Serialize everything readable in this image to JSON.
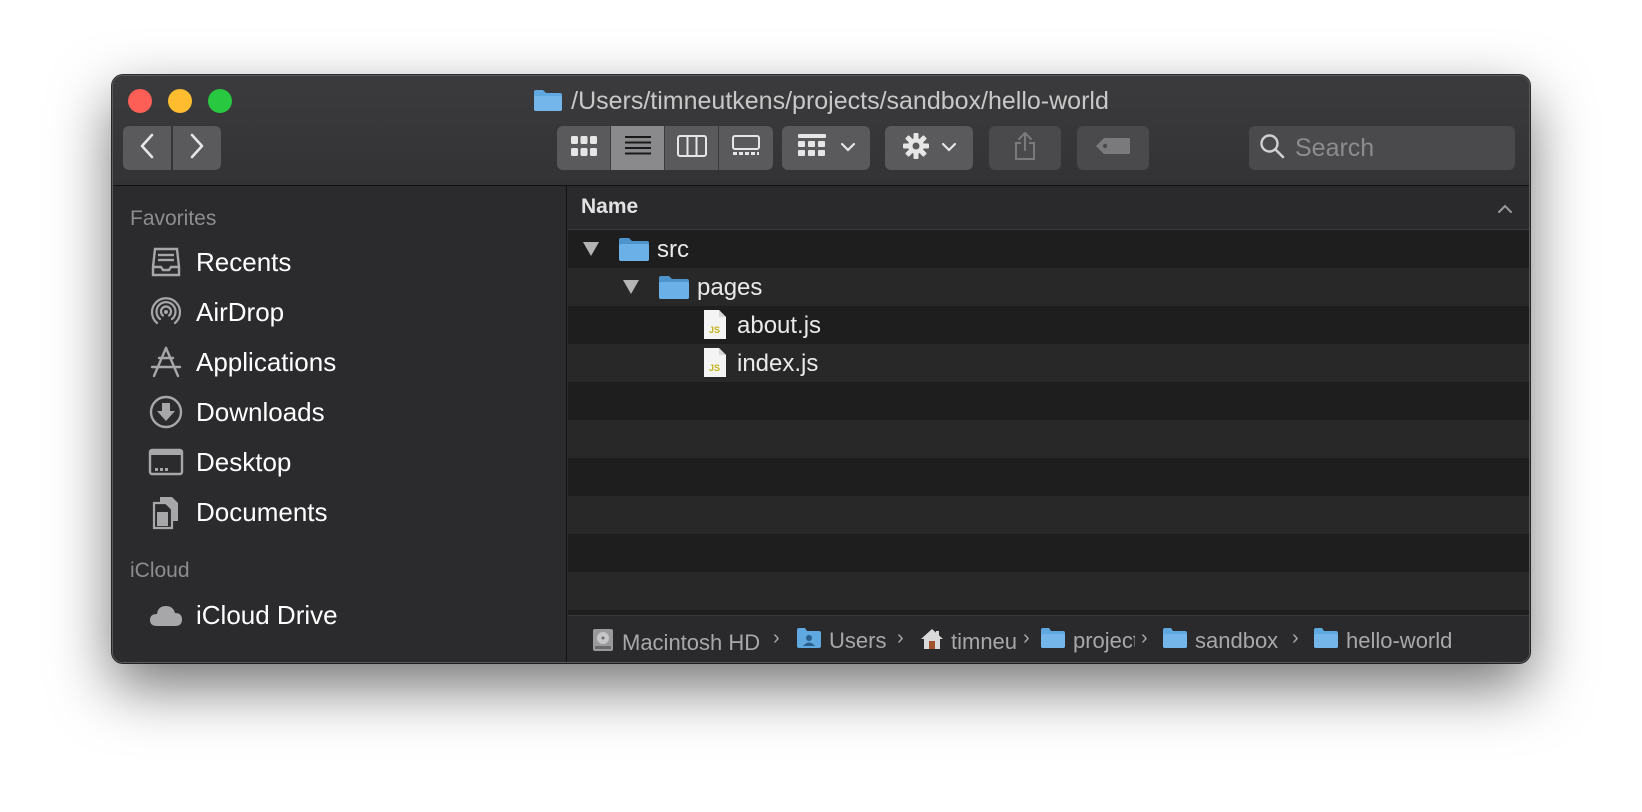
{
  "window": {
    "title": "/Users/timneutkens/projects/sandbox/hello-world"
  },
  "toolbar": {
    "back_icon": "chevron-left-icon",
    "forward_icon": "chevron-right-icon",
    "view_modes": [
      "icon-view-icon",
      "list-view-icon",
      "column-view-icon",
      "gallery-view-icon"
    ],
    "active_view": "list",
    "search_placeholder": "Search"
  },
  "sidebar": {
    "favorites_label": "Favorites",
    "icloud_label": "iCloud",
    "items": [
      {
        "label": "Recents",
        "icon": "recents-icon"
      },
      {
        "label": "AirDrop",
        "icon": "airdrop-icon"
      },
      {
        "label": "Applications",
        "icon": "applications-icon"
      },
      {
        "label": "Downloads",
        "icon": "downloads-icon"
      },
      {
        "label": "Desktop",
        "icon": "desktop-icon"
      },
      {
        "label": "Documents",
        "icon": "documents-icon"
      }
    ],
    "icloud_items": [
      {
        "label": "iCloud Drive",
        "icon": "cloud-icon"
      }
    ]
  },
  "list": {
    "column_name": "Name",
    "rows": [
      {
        "name": "src",
        "type": "folder",
        "level": 0,
        "expanded": true
      },
      {
        "name": "pages",
        "type": "folder",
        "level": 1,
        "expanded": true
      },
      {
        "name": "about.js",
        "type": "js-file",
        "level": 2
      },
      {
        "name": "index.js",
        "type": "js-file",
        "level": 2
      }
    ]
  },
  "pathbar": {
    "crumbs": [
      {
        "label": "Macintosh HD",
        "icon": "hard-drive-icon"
      },
      {
        "label": "Users",
        "icon": "users-folder-icon"
      },
      {
        "label": "timneutkens",
        "icon": "home-icon"
      },
      {
        "label": "projects",
        "icon": "folder-icon"
      },
      {
        "label": "sandbox",
        "icon": "folder-icon"
      },
      {
        "label": "hello-world",
        "icon": "folder-icon"
      }
    ],
    "separator": "›"
  },
  "colors": {
    "folder": "#5fa8e0",
    "close": "#fd5f57",
    "minimize": "#febc2e",
    "maximize": "#28c840",
    "js_badge": "#c4b21a"
  }
}
